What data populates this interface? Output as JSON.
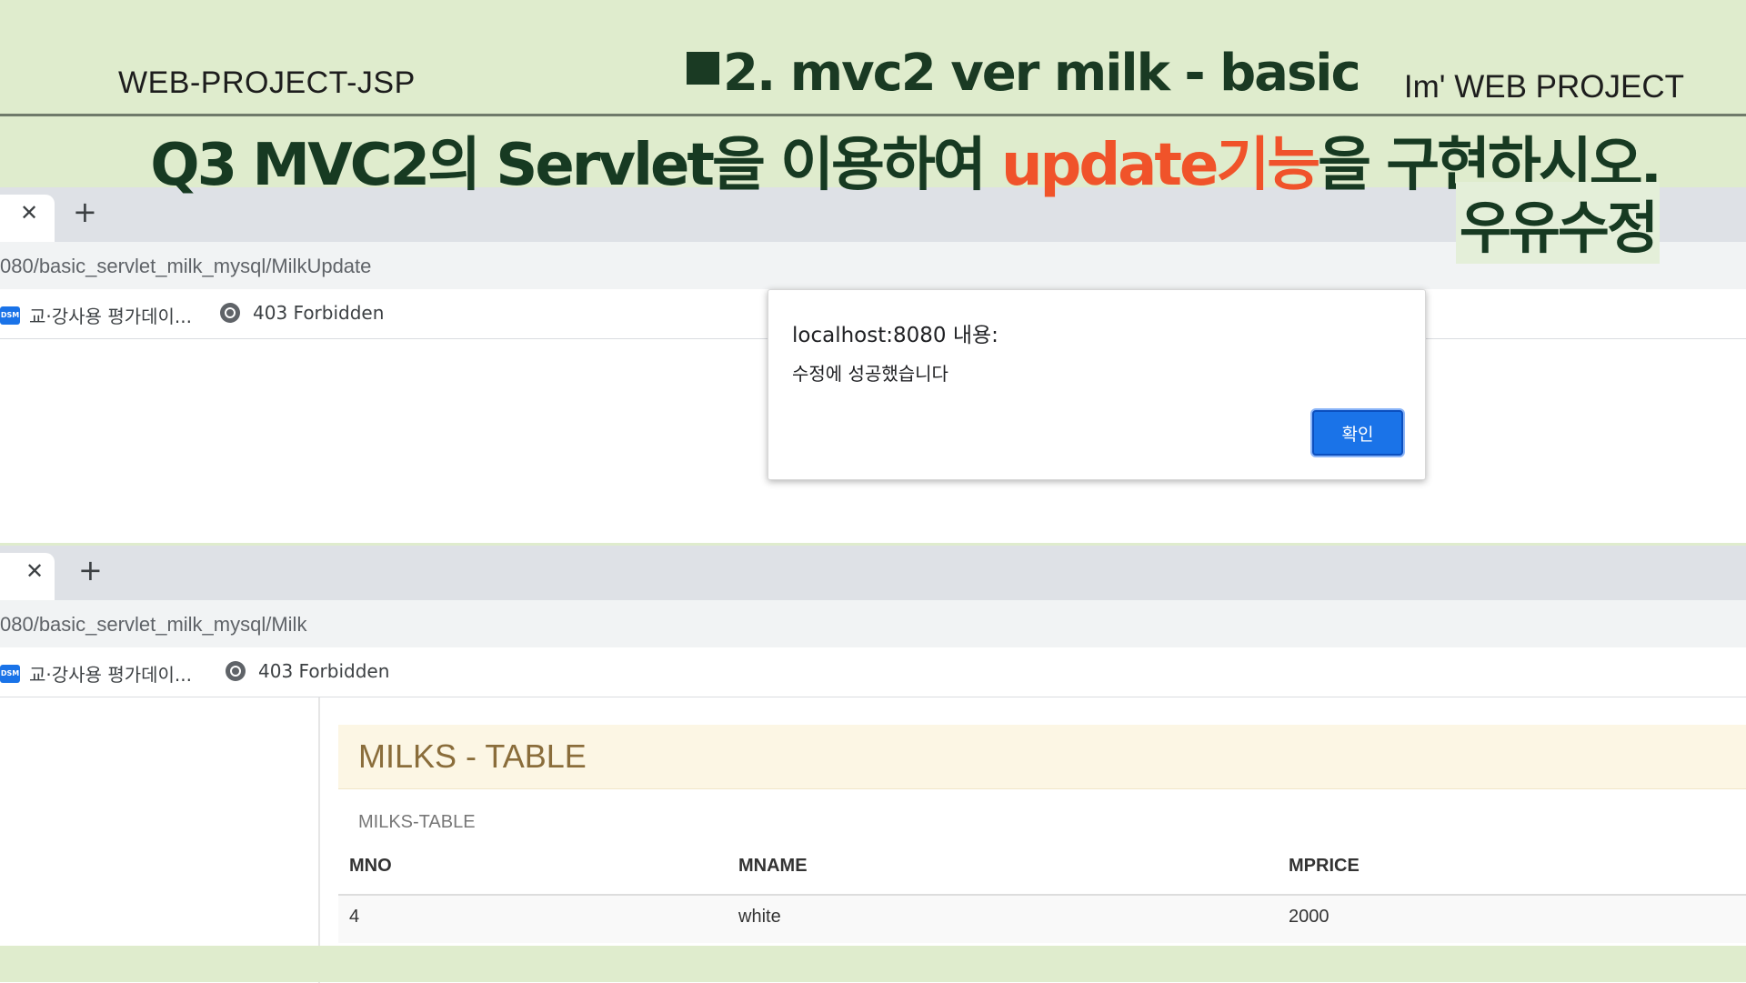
{
  "slide": {
    "left_title": "WEB-PROJECT-JSP",
    "center_title": "2. mvc2 ver  milk - basic",
    "right_title": "Im'  WEB PROJECT",
    "question_prefix": "Q3  MVC2의 Servlet을 이용하여 ",
    "question_highlight": "update기능",
    "question_suffix": "을 구현하시오.",
    "subtitle": "우유수정",
    "highlight_color": "#f0532a",
    "title_color": "#173a22"
  },
  "browser_top": {
    "url": "080/basic_servlet_milk_mysql/MilkUpdate",
    "bookmarks": [
      {
        "label": "교·강사용 평가데이...",
        "icon": "dsm-icon"
      },
      {
        "label": "403 Forbidden",
        "icon": "globe-icon"
      }
    ],
    "dialog": {
      "origin": "localhost:8080 내용:",
      "message": "수정에 성공했습니다",
      "ok_label": "확인"
    }
  },
  "browser_bottom": {
    "url": "080/basic_servlet_milk_mysql/Milk",
    "bookmarks": [
      {
        "label": "교·강사용 평가데이...",
        "icon": "dsm-icon"
      },
      {
        "label": "403 Forbidden",
        "icon": "globe-icon"
      }
    ],
    "panel_title": "MILKS - TABLE",
    "table_caption": "MILKS-TABLE",
    "columns": [
      "MNO",
      "MNAME",
      "MPRICE"
    ],
    "rows": [
      [
        "4",
        "white",
        "2000"
      ]
    ]
  }
}
